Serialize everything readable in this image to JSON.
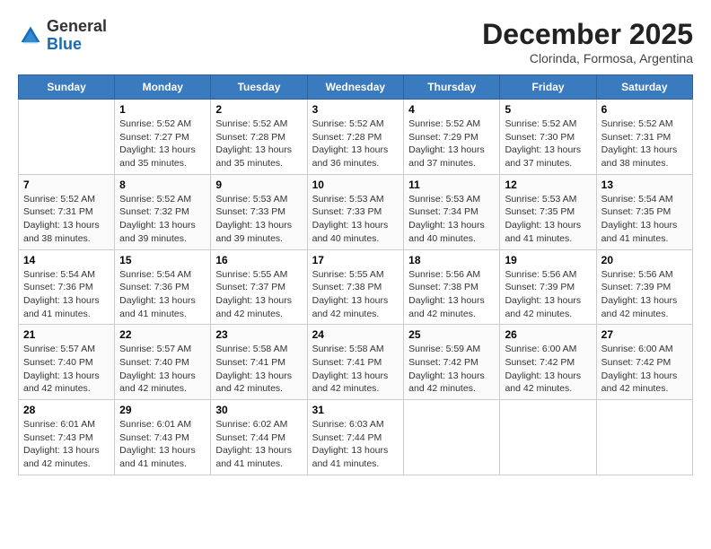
{
  "header": {
    "logo_general": "General",
    "logo_blue": "Blue",
    "month_title": "December 2025",
    "subtitle": "Clorinda, Formosa, Argentina"
  },
  "days_of_week": [
    "Sunday",
    "Monday",
    "Tuesday",
    "Wednesday",
    "Thursday",
    "Friday",
    "Saturday"
  ],
  "weeks": [
    [
      {
        "day": "",
        "sunrise": "",
        "sunset": "",
        "daylight": ""
      },
      {
        "day": "1",
        "sunrise": "Sunrise: 5:52 AM",
        "sunset": "Sunset: 7:27 PM",
        "daylight": "Daylight: 13 hours and 35 minutes."
      },
      {
        "day": "2",
        "sunrise": "Sunrise: 5:52 AM",
        "sunset": "Sunset: 7:28 PM",
        "daylight": "Daylight: 13 hours and 35 minutes."
      },
      {
        "day": "3",
        "sunrise": "Sunrise: 5:52 AM",
        "sunset": "Sunset: 7:28 PM",
        "daylight": "Daylight: 13 hours and 36 minutes."
      },
      {
        "day": "4",
        "sunrise": "Sunrise: 5:52 AM",
        "sunset": "Sunset: 7:29 PM",
        "daylight": "Daylight: 13 hours and 37 minutes."
      },
      {
        "day": "5",
        "sunrise": "Sunrise: 5:52 AM",
        "sunset": "Sunset: 7:30 PM",
        "daylight": "Daylight: 13 hours and 37 minutes."
      },
      {
        "day": "6",
        "sunrise": "Sunrise: 5:52 AM",
        "sunset": "Sunset: 7:31 PM",
        "daylight": "Daylight: 13 hours and 38 minutes."
      }
    ],
    [
      {
        "day": "7",
        "sunrise": "Sunrise: 5:52 AM",
        "sunset": "Sunset: 7:31 PM",
        "daylight": "Daylight: 13 hours and 38 minutes."
      },
      {
        "day": "8",
        "sunrise": "Sunrise: 5:52 AM",
        "sunset": "Sunset: 7:32 PM",
        "daylight": "Daylight: 13 hours and 39 minutes."
      },
      {
        "day": "9",
        "sunrise": "Sunrise: 5:53 AM",
        "sunset": "Sunset: 7:33 PM",
        "daylight": "Daylight: 13 hours and 39 minutes."
      },
      {
        "day": "10",
        "sunrise": "Sunrise: 5:53 AM",
        "sunset": "Sunset: 7:33 PM",
        "daylight": "Daylight: 13 hours and 40 minutes."
      },
      {
        "day": "11",
        "sunrise": "Sunrise: 5:53 AM",
        "sunset": "Sunset: 7:34 PM",
        "daylight": "Daylight: 13 hours and 40 minutes."
      },
      {
        "day": "12",
        "sunrise": "Sunrise: 5:53 AM",
        "sunset": "Sunset: 7:35 PM",
        "daylight": "Daylight: 13 hours and 41 minutes."
      },
      {
        "day": "13",
        "sunrise": "Sunrise: 5:54 AM",
        "sunset": "Sunset: 7:35 PM",
        "daylight": "Daylight: 13 hours and 41 minutes."
      }
    ],
    [
      {
        "day": "14",
        "sunrise": "Sunrise: 5:54 AM",
        "sunset": "Sunset: 7:36 PM",
        "daylight": "Daylight: 13 hours and 41 minutes."
      },
      {
        "day": "15",
        "sunrise": "Sunrise: 5:54 AM",
        "sunset": "Sunset: 7:36 PM",
        "daylight": "Daylight: 13 hours and 41 minutes."
      },
      {
        "day": "16",
        "sunrise": "Sunrise: 5:55 AM",
        "sunset": "Sunset: 7:37 PM",
        "daylight": "Daylight: 13 hours and 42 minutes."
      },
      {
        "day": "17",
        "sunrise": "Sunrise: 5:55 AM",
        "sunset": "Sunset: 7:38 PM",
        "daylight": "Daylight: 13 hours and 42 minutes."
      },
      {
        "day": "18",
        "sunrise": "Sunrise: 5:56 AM",
        "sunset": "Sunset: 7:38 PM",
        "daylight": "Daylight: 13 hours and 42 minutes."
      },
      {
        "day": "19",
        "sunrise": "Sunrise: 5:56 AM",
        "sunset": "Sunset: 7:39 PM",
        "daylight": "Daylight: 13 hours and 42 minutes."
      },
      {
        "day": "20",
        "sunrise": "Sunrise: 5:56 AM",
        "sunset": "Sunset: 7:39 PM",
        "daylight": "Daylight: 13 hours and 42 minutes."
      }
    ],
    [
      {
        "day": "21",
        "sunrise": "Sunrise: 5:57 AM",
        "sunset": "Sunset: 7:40 PM",
        "daylight": "Daylight: 13 hours and 42 minutes."
      },
      {
        "day": "22",
        "sunrise": "Sunrise: 5:57 AM",
        "sunset": "Sunset: 7:40 PM",
        "daylight": "Daylight: 13 hours and 42 minutes."
      },
      {
        "day": "23",
        "sunrise": "Sunrise: 5:58 AM",
        "sunset": "Sunset: 7:41 PM",
        "daylight": "Daylight: 13 hours and 42 minutes."
      },
      {
        "day": "24",
        "sunrise": "Sunrise: 5:58 AM",
        "sunset": "Sunset: 7:41 PM",
        "daylight": "Daylight: 13 hours and 42 minutes."
      },
      {
        "day": "25",
        "sunrise": "Sunrise: 5:59 AM",
        "sunset": "Sunset: 7:42 PM",
        "daylight": "Daylight: 13 hours and 42 minutes."
      },
      {
        "day": "26",
        "sunrise": "Sunrise: 6:00 AM",
        "sunset": "Sunset: 7:42 PM",
        "daylight": "Daylight: 13 hours and 42 minutes."
      },
      {
        "day": "27",
        "sunrise": "Sunrise: 6:00 AM",
        "sunset": "Sunset: 7:42 PM",
        "daylight": "Daylight: 13 hours and 42 minutes."
      }
    ],
    [
      {
        "day": "28",
        "sunrise": "Sunrise: 6:01 AM",
        "sunset": "Sunset: 7:43 PM",
        "daylight": "Daylight: 13 hours and 42 minutes."
      },
      {
        "day": "29",
        "sunrise": "Sunrise: 6:01 AM",
        "sunset": "Sunset: 7:43 PM",
        "daylight": "Daylight: 13 hours and 41 minutes."
      },
      {
        "day": "30",
        "sunrise": "Sunrise: 6:02 AM",
        "sunset": "Sunset: 7:44 PM",
        "daylight": "Daylight: 13 hours and 41 minutes."
      },
      {
        "day": "31",
        "sunrise": "Sunrise: 6:03 AM",
        "sunset": "Sunset: 7:44 PM",
        "daylight": "Daylight: 13 hours and 41 minutes."
      },
      {
        "day": "",
        "sunrise": "",
        "sunset": "",
        "daylight": ""
      },
      {
        "day": "",
        "sunrise": "",
        "sunset": "",
        "daylight": ""
      },
      {
        "day": "",
        "sunrise": "",
        "sunset": "",
        "daylight": ""
      }
    ]
  ]
}
